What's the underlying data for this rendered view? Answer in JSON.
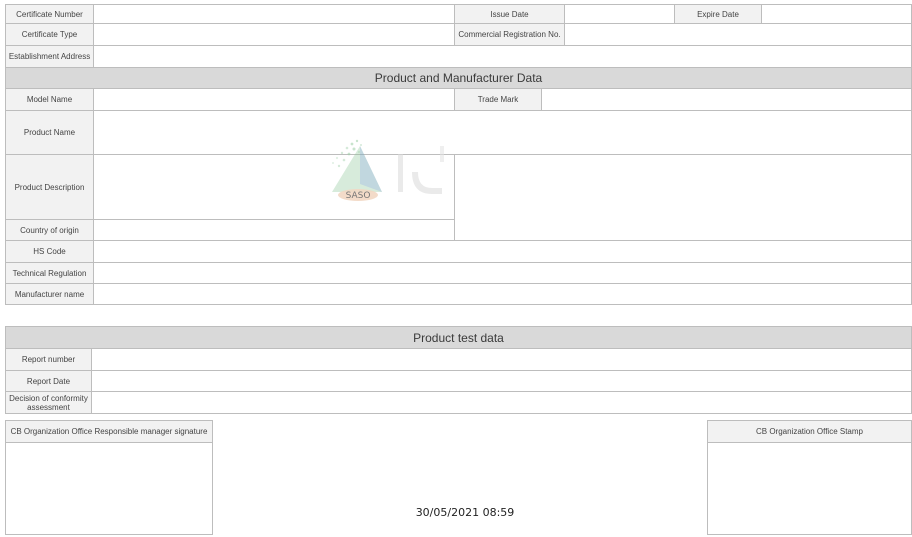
{
  "certificate": {
    "number_label": "Certificate  Number",
    "issue_date_label": "Issue Date",
    "expire_date_label": "Expire Date",
    "type_label": "Certificate Type",
    "commercial_reg_label": "Commercial Registration No.",
    "address_label": "Establishment Address"
  },
  "product_section": {
    "title": "Product and Manufacturer Data",
    "model_name_label": "Model Name",
    "trade_mark_label": "Trade Mark",
    "product_name_label": "Product Name",
    "product_description_label": "Product Description",
    "country_label": "Country of origin",
    "hs_code_label": "HS Code",
    "technical_regulation_label": "Technical Regulation",
    "manufacturer_label": "Manufacturer name"
  },
  "test_section": {
    "title": "Product test data",
    "report_number_label": "Report number",
    "report_date_label": "Report Date",
    "decision_label": "Decision of conformity assessment"
  },
  "signature": {
    "manager_label": "CB Organization Office Responsible manager signature",
    "stamp_label": "CB Organization Office Stamp"
  },
  "timestamp": "30/05/2021 08:59",
  "watermark": {
    "logo_text": "SASO",
    "colors": {
      "green": "#8fc79a",
      "blue": "#7fa7c9",
      "orange": "#e8b892"
    }
  }
}
